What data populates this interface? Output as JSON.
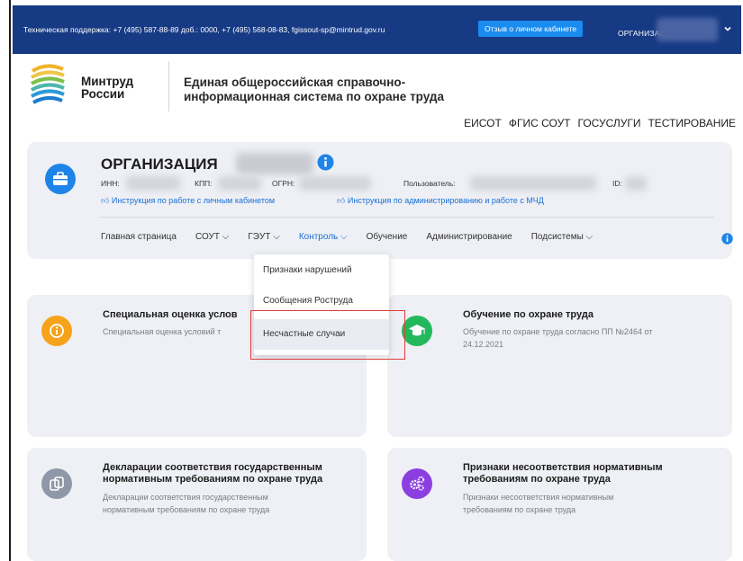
{
  "topbar": {
    "support_text": "Техническая поддержка: +7 (495) 587-88-89 доб.: 0000, +7 (495) 568-08-83, fgissout-sp@mintrud.gov.ru",
    "feedback_button": "Отзыв о личном кабинете",
    "org_label": "ОРГАНИЗАЦИЯ"
  },
  "header": {
    "brand_line1": "Минтруд",
    "brand_line2": "России",
    "system_title_line1": "Единая общероссийская справочно-",
    "system_title_line2": "информационная система по охране труда",
    "links": [
      "ЕИСОТ",
      "ФГИС СОУТ",
      "ГОСУСЛУГИ",
      "ТЕСТИРОВАНИЕ"
    ]
  },
  "cabinet": {
    "org_title": "ОРГАНИЗАЦИЯ",
    "inn_label": "ИНН:",
    "kpp_label": "КПП:",
    "ogrn_label": "ОГРН:",
    "user_label": "Пользователь:",
    "id_label": "ID:",
    "instruction_1": "Инструкция по работе с личным кабинетом",
    "instruction_2": "Инструкция по администрированию и работе с МЧД",
    "nav": [
      "Главная страница",
      "СОУТ",
      "ГЭУТ",
      "Контроль",
      "Обучение",
      "Администрирование",
      "Подсистемы"
    ]
  },
  "dropdown": {
    "items": [
      "Признаки нарушений",
      "Сообщения Роструда",
      "Несчастные случаи"
    ]
  },
  "cards": [
    {
      "title": "Специальная оценка услов",
      "desc_line1": "Специальная оценка условий т",
      "desc_line2": ""
    },
    {
      "title": "Обучение по охране труда",
      "desc_line1": "Обучение по охране труда согласно ПП №2464 от",
      "desc_line2": "24.12.2021"
    },
    {
      "title_line1": "Декларации соответствия государственным",
      "title_line2": "нормативным требованиям по охране труда",
      "desc_line1": "Декларации соответствия государственным",
      "desc_line2": "нормативным требованиям по охране труда"
    },
    {
      "title_line1": "Признаки несоответствия нормативным",
      "title_line2": "требованиям по охране труда",
      "desc_line1": "Признаки несоответствия нормативным",
      "desc_line2": "требованиям по охране труда"
    }
  ],
  "colors": {
    "topbar": "#173a84",
    "accent": "#1a6fd4",
    "card_bg": "#eef0f5",
    "highlight": "#e03a3a"
  }
}
